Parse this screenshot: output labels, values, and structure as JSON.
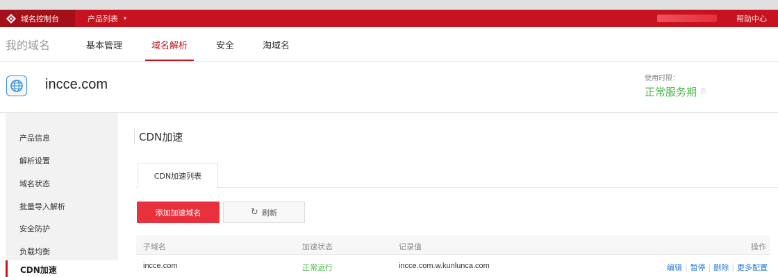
{
  "topbar": {
    "console_title": "域名控制台",
    "product_list": "产品列表",
    "help": "帮助中心"
  },
  "subnav": {
    "brand": "我的域名",
    "items": [
      "基本管理",
      "域名解析",
      "安全",
      "淘域名"
    ],
    "active": "域名解析"
  },
  "domain": {
    "name": "incce.com",
    "usage_label": "使用时限：",
    "usage_value": "正常服务期"
  },
  "sidebar": {
    "items": [
      "产品信息",
      "解析设置",
      "域名状态",
      "批量导入解析",
      "安全防护",
      "负载均衡",
      "CDN加速"
    ],
    "active": "CDN加速"
  },
  "main": {
    "title": "CDN加速",
    "tab": "CDN加速列表",
    "add_button": "添加加速域名",
    "refresh_button": "刷新",
    "table": {
      "headers": [
        "子域名",
        "加速状态",
        "记录值",
        "操作"
      ],
      "rows": [
        {
          "subdomain": "incce.com",
          "status": "正常运行",
          "record": "incce.com.w.kunlunca.com",
          "actions": [
            "编辑",
            "暂停",
            "删除",
            "更多配置"
          ]
        }
      ]
    }
  },
  "colors": {
    "brand_red": "#c7131f",
    "button_red": "#e8313c",
    "status_green": "#47b847",
    "link_blue": "#2b7bd6"
  },
  "icons": [
    "logo-icon",
    "chevron-down-icon",
    "globe-icon",
    "info-icon",
    "refresh-icon"
  ]
}
